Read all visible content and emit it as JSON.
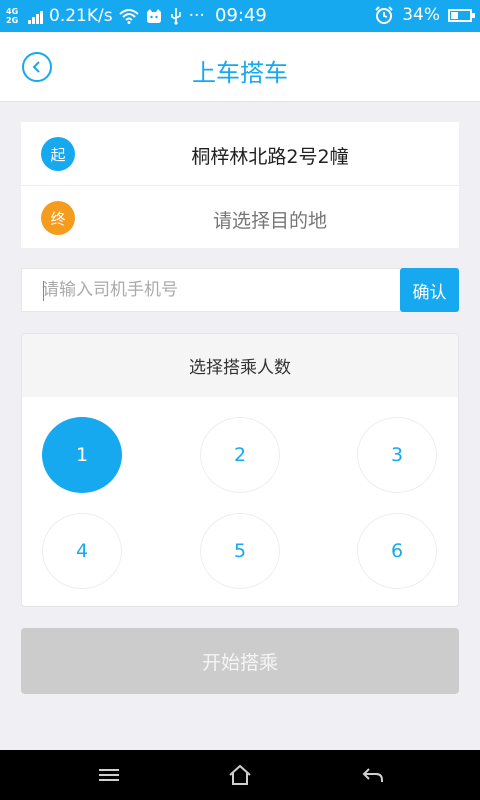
{
  "status_bar": {
    "network_top": "4G",
    "network_bottom": "2G",
    "speed": "0.21K/s",
    "more": "···",
    "time": "09:49",
    "battery": "34%"
  },
  "header": {
    "title": "上车搭车",
    "back_icon": "chevron-left-icon"
  },
  "route": {
    "start_badge": "起",
    "start_address": "桐梓林北路2号2幢",
    "end_badge": "终",
    "end_placeholder": "请选择目的地"
  },
  "phone": {
    "placeholder": "请输入司机手机号",
    "value": "",
    "confirm_label": "确认"
  },
  "seats": {
    "title": "选择搭乘人数",
    "options": [
      "1",
      "2",
      "3",
      "4",
      "5",
      "6"
    ],
    "selected": "1"
  },
  "start_button": "开始搭乘",
  "colors": {
    "accent": "#17a9f0",
    "end_badge": "#f59b1e",
    "disabled_button": "#cccccc"
  },
  "nav_icons": [
    "menu-icon",
    "home-icon",
    "back-icon"
  ]
}
